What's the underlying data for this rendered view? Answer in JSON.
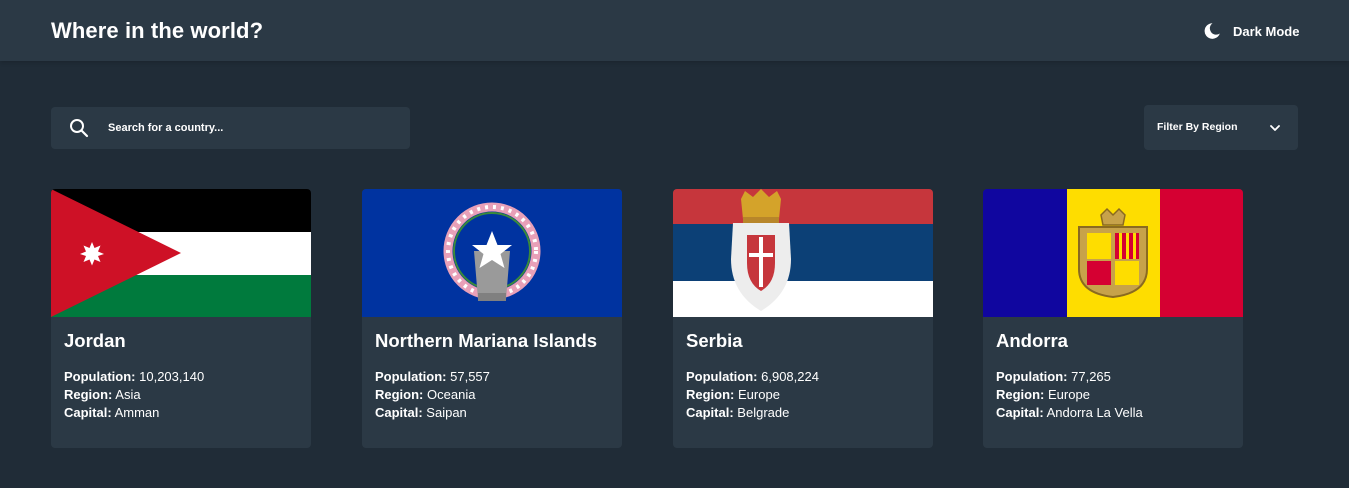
{
  "header": {
    "title": "Where in the world?",
    "mode_label": "Dark Mode",
    "mode_icon": "moon-icon"
  },
  "search": {
    "placeholder": "Search for a country...",
    "value": "",
    "icon": "search-icon"
  },
  "filter": {
    "label": "Filter By Region",
    "icon": "chevron-down-icon"
  },
  "labels": {
    "population": "Population:",
    "region": "Region:",
    "capital": "Capital:"
  },
  "countries": [
    {
      "name": "Jordan",
      "population": "10,203,140",
      "region": "Asia",
      "capital": "Amman",
      "flag": "jordan-flag"
    },
    {
      "name": "Northern Mariana Islands",
      "population": "57,557",
      "region": "Oceania",
      "capital": "Saipan",
      "flag": "northern-mariana-islands-flag"
    },
    {
      "name": "Serbia",
      "population": "6,908,224",
      "region": "Europe",
      "capital": "Belgrade",
      "flag": "serbia-flag"
    },
    {
      "name": "Andorra",
      "population": "77,265",
      "region": "Europe",
      "capital": "Andorra La Vella",
      "flag": "andorra-flag"
    }
  ],
  "colors": {
    "background": "#202c37",
    "elements": "#2b3945",
    "text": "#ffffff"
  }
}
